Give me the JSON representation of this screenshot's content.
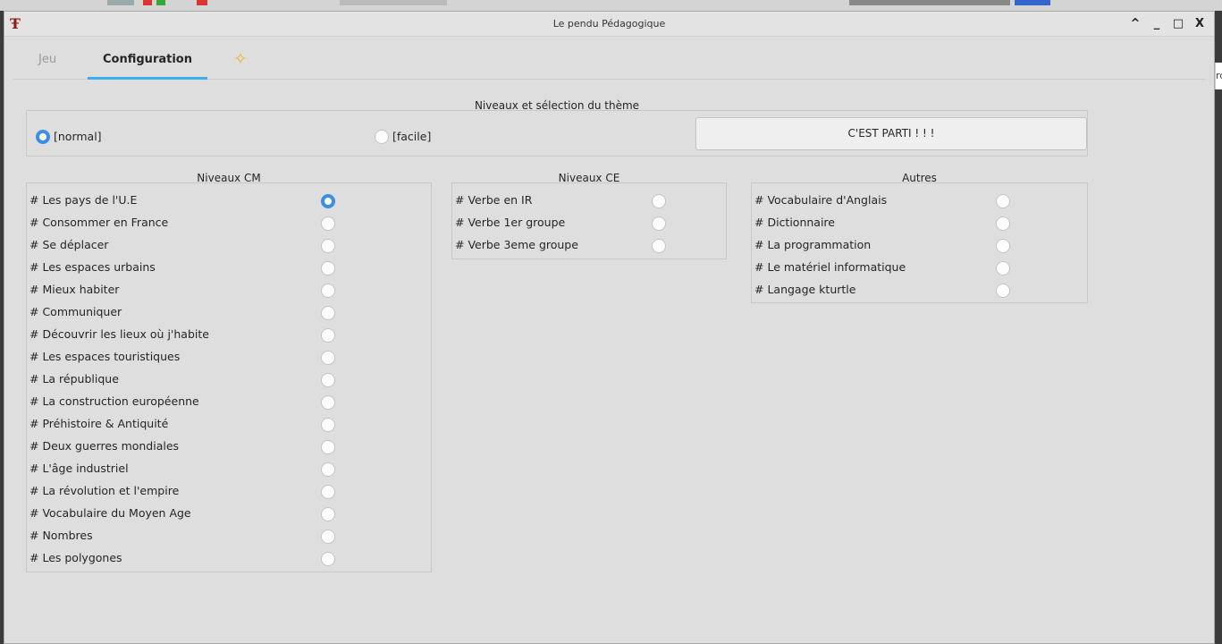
{
  "window": {
    "title": "Le pendu Pédagogique",
    "app_icon": "Ŧ",
    "controls": {
      "shade": "^",
      "minimize": "_",
      "maximize": "□",
      "close": "X"
    }
  },
  "tabs": [
    {
      "label": "Jeu"
    },
    {
      "label": "Configuration",
      "selected": true
    },
    {
      "label": "",
      "icon": "star-icon"
    }
  ],
  "levels_group": {
    "title": "Niveaux et sélection du thème",
    "options": [
      {
        "label": "[normal]",
        "checked": true
      },
      {
        "label": "[facile]",
        "checked": false
      }
    ],
    "go_button": "C'EST PARTI ! ! !"
  },
  "cm_group": {
    "title": "Niveaux CM",
    "items": [
      {
        "label": "# Les pays de l'U.E",
        "checked": true
      },
      {
        "label": "# Consommer en France",
        "checked": false
      },
      {
        "label": "# Se déplacer",
        "checked": false
      },
      {
        "label": "# Les espaces urbains",
        "checked": false
      },
      {
        "label": "# Mieux habiter",
        "checked": false
      },
      {
        "label": "# Communiquer",
        "checked": false
      },
      {
        "label": "# Découvrir les  lieux où j'habite",
        "checked": false
      },
      {
        "label": "# Les espaces touristiques",
        "checked": false
      },
      {
        "label": "# La république",
        "checked": false
      },
      {
        "label": "# La construction européenne",
        "checked": false
      },
      {
        "label": "# Préhistoire & Antiquité",
        "checked": false
      },
      {
        "label": "# Deux guerres mondiales",
        "checked": false
      },
      {
        "label": "# L'âge industriel",
        "checked": false
      },
      {
        "label": "# La révolution et l'empire",
        "checked": false
      },
      {
        "label": "# Vocabulaire du Moyen Age",
        "checked": false
      },
      {
        "label": "# Nombres",
        "checked": false
      },
      {
        "label": "# Les polygones",
        "checked": false
      }
    ]
  },
  "ce_group": {
    "title": "Niveaux CE",
    "items": [
      {
        "label": "# Verbe en IR",
        "checked": false
      },
      {
        "label": "# Verbe 1er groupe",
        "checked": false
      },
      {
        "label": "# Verbe 3eme groupe",
        "checked": false
      }
    ]
  },
  "other_group": {
    "title": "Autres",
    "items": [
      {
        "label": "# Vocabulaire d'Anglais",
        "checked": false
      },
      {
        "label": "# Dictionnaire",
        "checked": false
      },
      {
        "label": "# La programmation",
        "checked": false
      },
      {
        "label": "# Le matériel informatique",
        "checked": false
      },
      {
        "label": "# Langage kturtle",
        "checked": false
      }
    ]
  },
  "colors": {
    "accent": "#3d8ee6",
    "tab_underline": "#3daee9",
    "window_bg": "#dedede",
    "icon_red": "#8b1a1a",
    "star": "#e8b928"
  }
}
